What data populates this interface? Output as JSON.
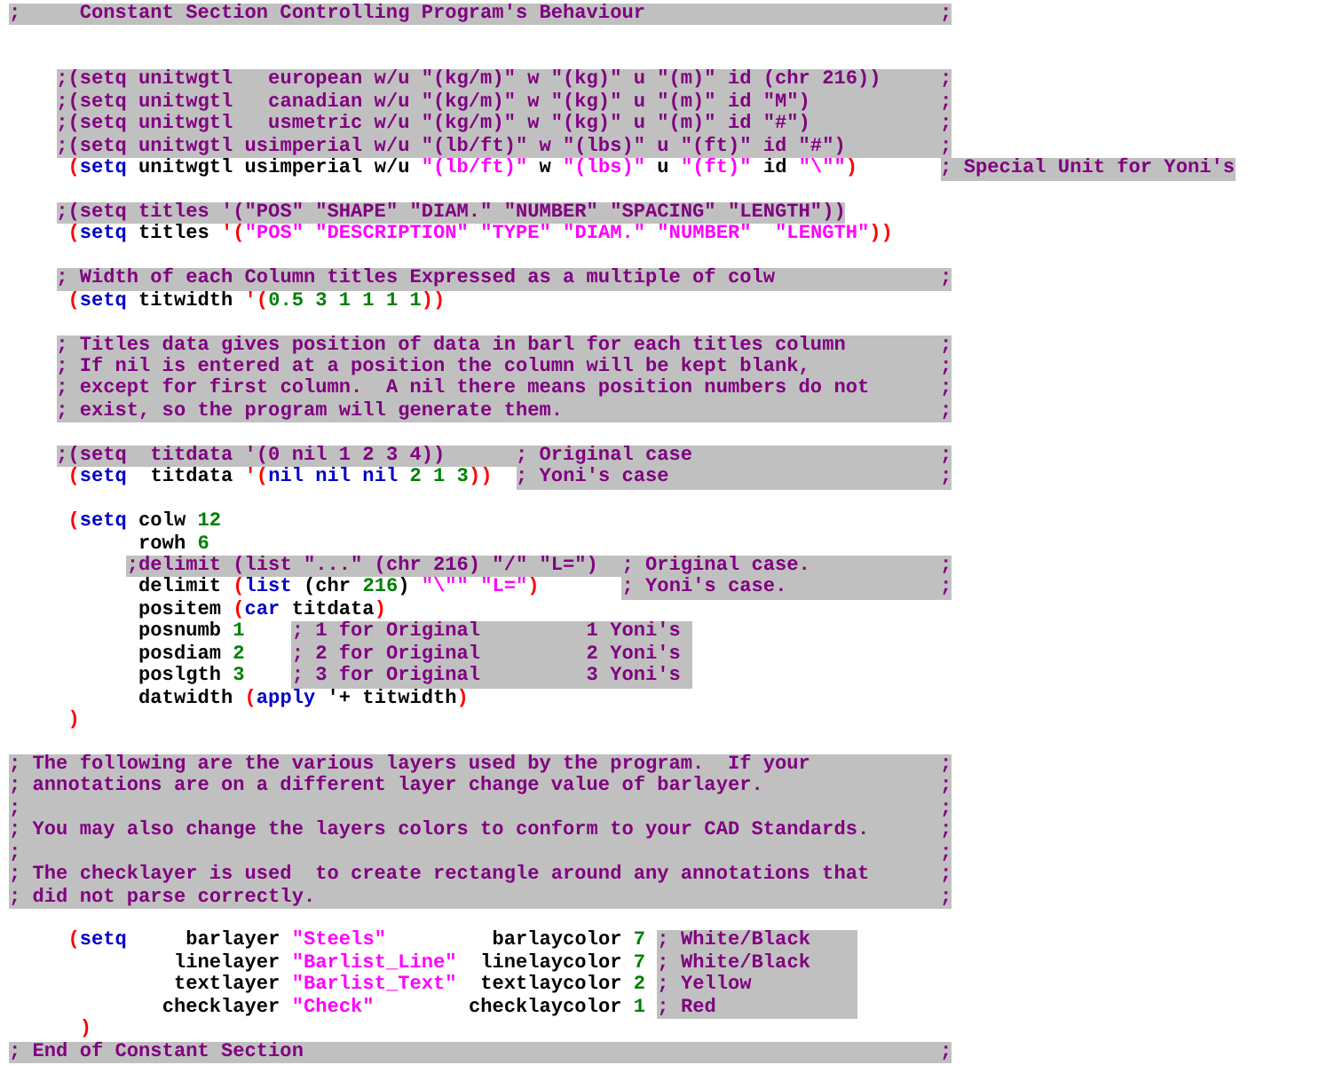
{
  "editor": {
    "lines": [
      {
        "kind": "code",
        "tokens": [
          {
            "kind": "comment",
            "text": ";     Constant Section Controlling Program's Behaviour                         ;"
          }
        ]
      },
      {
        "kind": "blank"
      },
      {
        "kind": "blank"
      },
      {
        "kind": "code",
        "tokens": [
          {
            "kind": "comment",
            "text": "    ;(setq unitwgtl   european w/u \"(kg/m)\" w \"(kg)\" u \"(m)\" id (chr 216))     ;"
          }
        ]
      },
      {
        "kind": "code",
        "tokens": [
          {
            "kind": "comment",
            "text": "    ;(setq unitwgtl   canadian w/u \"(kg/m)\" w \"(kg)\" u \"(m)\" id \"M\")           ;"
          }
        ]
      },
      {
        "kind": "code",
        "tokens": [
          {
            "kind": "comment",
            "text": "    ;(setq unitwgtl   usmetric w/u \"(kg/m)\" w \"(kg)\" u \"(m)\" id \"#\")           ;"
          }
        ]
      },
      {
        "kind": "code",
        "tokens": [
          {
            "kind": "comment",
            "text": "    ;(setq unitwgtl usimperial w/u \"(lb/ft)\" w \"(lbs)\" u \"(ft)\" id \"#\")        ;"
          }
        ]
      },
      {
        "kind": "code",
        "tokens": [
          {
            "kind": "paren",
            "text": "     ("
          },
          {
            "kind": "keyword",
            "text": "setq"
          },
          {
            "kind": "text",
            "text": " unitwgtl usimperial w/u "
          },
          {
            "kind": "string",
            "text": "\"(lb/ft)\""
          },
          {
            "kind": "text",
            "text": " w "
          },
          {
            "kind": "string",
            "text": "\"(lbs)\""
          },
          {
            "kind": "text",
            "text": " u "
          },
          {
            "kind": "string",
            "text": "\"(ft)\""
          },
          {
            "kind": "text",
            "text": " id "
          },
          {
            "kind": "string",
            "text": "\"\\\"\""
          },
          {
            "kind": "paren",
            "text": ")"
          },
          {
            "kind": "comment",
            "text": "       ; Special Unit for Yoni's"
          }
        ]
      },
      {
        "kind": "blank"
      },
      {
        "kind": "code",
        "tokens": [
          {
            "kind": "comment",
            "text": "    ;(setq titles '(\"POS\" \"SHAPE\" \"DIAM.\" \"NUMBER\" \"SPACING\" \"LENGTH\"))"
          }
        ]
      },
      {
        "kind": "code",
        "tokens": [
          {
            "kind": "paren",
            "text": "     ("
          },
          {
            "kind": "keyword",
            "text": "setq"
          },
          {
            "kind": "text",
            "text": " titles "
          },
          {
            "kind": "paren",
            "text": "'("
          },
          {
            "kind": "string",
            "text": "\"POS\" \"DESCRIPTION\" \"TYPE\" \"DIAM.\" \"NUMBER\"  \"LENGTH\""
          },
          {
            "kind": "paren",
            "text": "))"
          }
        ]
      },
      {
        "kind": "blank"
      },
      {
        "kind": "code",
        "tokens": [
          {
            "kind": "comment",
            "text": "    ; Width of each Column titles Expressed as a multiple of colw              ;"
          }
        ]
      },
      {
        "kind": "code",
        "tokens": [
          {
            "kind": "paren",
            "text": "     ("
          },
          {
            "kind": "keyword",
            "text": "setq"
          },
          {
            "kind": "text",
            "text": " titwidth "
          },
          {
            "kind": "paren",
            "text": "'("
          },
          {
            "kind": "number",
            "text": "0.5 3 1 1 1 1"
          },
          {
            "kind": "paren",
            "text": "))"
          }
        ]
      },
      {
        "kind": "blank"
      },
      {
        "kind": "code",
        "tokens": [
          {
            "kind": "comment",
            "text": "    ; Titles data gives position of data in barl for each titles column        ;"
          }
        ]
      },
      {
        "kind": "code",
        "tokens": [
          {
            "kind": "comment",
            "text": "    ; If nil is entered at a position the column will be kept blank,           ;"
          }
        ]
      },
      {
        "kind": "code",
        "tokens": [
          {
            "kind": "comment",
            "text": "    ; except for first column.  A nil there means position numbers do not      ;"
          }
        ]
      },
      {
        "kind": "code",
        "tokens": [
          {
            "kind": "comment",
            "text": "    ; exist, so the program will generate them.                                ;"
          }
        ]
      },
      {
        "kind": "blank"
      },
      {
        "kind": "code",
        "tokens": [
          {
            "kind": "comment",
            "text": "    ;(setq  titdata '(0 nil 1 2 3 4))      ; Original case                     ;"
          }
        ]
      },
      {
        "kind": "code",
        "tokens": [
          {
            "kind": "paren",
            "text": "     ("
          },
          {
            "kind": "keyword",
            "text": "setq"
          },
          {
            "kind": "text",
            "text": "  titdata "
          },
          {
            "kind": "paren",
            "text": "'("
          },
          {
            "kind": "keyword",
            "text": "nil nil nil"
          },
          {
            "kind": "number",
            "text": " 2 1 3"
          },
          {
            "kind": "paren",
            "text": "))"
          },
          {
            "kind": "comment",
            "text": "  ; Yoni's case                       ;"
          }
        ]
      },
      {
        "kind": "blank"
      },
      {
        "kind": "code",
        "tokens": [
          {
            "kind": "paren",
            "text": "     ("
          },
          {
            "kind": "keyword",
            "text": "setq"
          },
          {
            "kind": "text",
            "text": " colw "
          },
          {
            "kind": "number",
            "text": "12"
          }
        ]
      },
      {
        "kind": "code",
        "tokens": [
          {
            "kind": "text",
            "text": "           rowh "
          },
          {
            "kind": "number",
            "text": "6"
          }
        ]
      },
      {
        "kind": "code",
        "tokens": [
          {
            "kind": "comment",
            "text": "          ;delimit (list \"...\" (chr 216) \"/\" \"L=\")  ; Original case.           ;"
          }
        ]
      },
      {
        "kind": "code",
        "tokens": [
          {
            "kind": "text",
            "text": "           delimit "
          },
          {
            "kind": "paren",
            "text": "("
          },
          {
            "kind": "keyword",
            "text": "list"
          },
          {
            "kind": "text",
            "text": " (chr "
          },
          {
            "kind": "number",
            "text": "216"
          },
          {
            "kind": "text",
            "text": ") "
          },
          {
            "kind": "string",
            "text": "\"\\\"\" \"L=\""
          },
          {
            "kind": "paren",
            "text": ")"
          },
          {
            "kind": "comment",
            "text": "       ; Yoni's case.             ;"
          }
        ]
      },
      {
        "kind": "code",
        "tokens": [
          {
            "kind": "text",
            "text": "           positem "
          },
          {
            "kind": "paren",
            "text": "("
          },
          {
            "kind": "keyword",
            "text": "car"
          },
          {
            "kind": "text",
            "text": " titdata"
          },
          {
            "kind": "paren",
            "text": ")"
          }
        ]
      },
      {
        "kind": "code",
        "tokens": [
          {
            "kind": "text",
            "text": "           posnumb "
          },
          {
            "kind": "number",
            "text": "1"
          },
          {
            "kind": "comment",
            "text": "    ; 1 for Original         1 Yoni's "
          }
        ]
      },
      {
        "kind": "code",
        "tokens": [
          {
            "kind": "text",
            "text": "           posdiam "
          },
          {
            "kind": "number",
            "text": "2"
          },
          {
            "kind": "comment",
            "text": "    ; 2 for Original         2 Yoni's "
          }
        ]
      },
      {
        "kind": "code",
        "tokens": [
          {
            "kind": "text",
            "text": "           poslgth "
          },
          {
            "kind": "number",
            "text": "3"
          },
          {
            "kind": "comment",
            "text": "    ; 3 for Original         3 Yoni's "
          }
        ]
      },
      {
        "kind": "code",
        "tokens": [
          {
            "kind": "text",
            "text": "           datwidth "
          },
          {
            "kind": "paren",
            "text": "("
          },
          {
            "kind": "keyword",
            "text": "apply"
          },
          {
            "kind": "text",
            "text": " '+ titwidth"
          },
          {
            "kind": "paren",
            "text": ")"
          }
        ]
      },
      {
        "kind": "code",
        "tokens": [
          {
            "kind": "paren",
            "text": "     )"
          }
        ]
      },
      {
        "kind": "blank"
      },
      {
        "kind": "code",
        "tokens": [
          {
            "kind": "comment",
            "text": "; The following are the various layers used by the program.  If your           ;"
          }
        ]
      },
      {
        "kind": "code",
        "tokens": [
          {
            "kind": "comment",
            "text": "; annotations are on a different layer change value of barlayer.               ;"
          }
        ]
      },
      {
        "kind": "code",
        "tokens": [
          {
            "kind": "comment",
            "text": ";                                                                              ;"
          }
        ]
      },
      {
        "kind": "code",
        "tokens": [
          {
            "kind": "comment",
            "text": "; You may also change the layers colors to conform to your CAD Standards.      ;"
          }
        ]
      },
      {
        "kind": "code",
        "tokens": [
          {
            "kind": "comment",
            "text": ";                                                                              ;"
          }
        ]
      },
      {
        "kind": "code",
        "tokens": [
          {
            "kind": "comment",
            "text": "; The checklayer is used  to create rectangle around any annotations that      ;"
          }
        ]
      },
      {
        "kind": "code",
        "tokens": [
          {
            "kind": "comment",
            "text": "; did not parse correctly.                                                     ;"
          }
        ]
      },
      {
        "kind": "blank"
      },
      {
        "kind": "code",
        "tokens": [
          {
            "kind": "paren",
            "text": "     ("
          },
          {
            "kind": "keyword",
            "text": "setq"
          },
          {
            "kind": "text",
            "text": "     barlayer "
          },
          {
            "kind": "string",
            "text": "\"Steels\""
          },
          {
            "kind": "text",
            "text": "         barlaycolor "
          },
          {
            "kind": "number",
            "text": "7"
          },
          {
            "kind": "comment",
            "text": " ; White/Black    "
          }
        ]
      },
      {
        "kind": "code",
        "tokens": [
          {
            "kind": "text",
            "text": "              linelayer "
          },
          {
            "kind": "string",
            "text": "\"Barlist_Line\""
          },
          {
            "kind": "text",
            "text": "  linelaycolor "
          },
          {
            "kind": "number",
            "text": "7"
          },
          {
            "kind": "comment",
            "text": " ; White/Black    "
          }
        ]
      },
      {
        "kind": "code",
        "tokens": [
          {
            "kind": "text",
            "text": "              textlayer "
          },
          {
            "kind": "string",
            "text": "\"Barlist_Text\""
          },
          {
            "kind": "text",
            "text": "  textlaycolor "
          },
          {
            "kind": "number",
            "text": "2"
          },
          {
            "kind": "comment",
            "text": " ; Yellow         "
          }
        ]
      },
      {
        "kind": "code",
        "tokens": [
          {
            "kind": "text",
            "text": "             checklayer "
          },
          {
            "kind": "string",
            "text": "\"Check\""
          },
          {
            "kind": "text",
            "text": "        checklaycolor "
          },
          {
            "kind": "number",
            "text": "1"
          },
          {
            "kind": "comment",
            "text": " ; Red            "
          }
        ]
      },
      {
        "kind": "code",
        "tokens": [
          {
            "kind": "paren",
            "text": "      )"
          }
        ]
      },
      {
        "kind": "code",
        "tokens": [
          {
            "kind": "comment",
            "text": "; End of Constant Section                                                      ;"
          }
        ]
      }
    ]
  }
}
